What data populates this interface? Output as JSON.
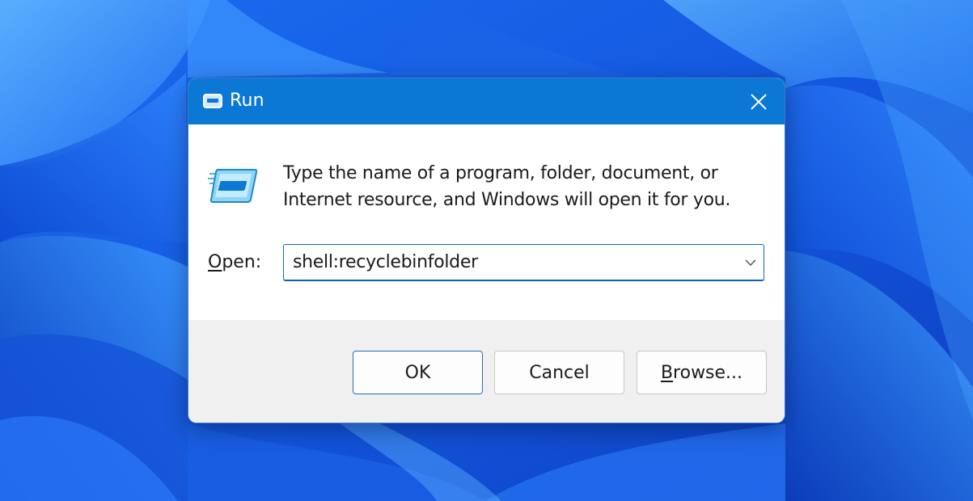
{
  "dialog": {
    "title": "Run",
    "description": "Type the name of a program, folder, document, or Internet resource, and Windows will open it for you.",
    "open_label_mnemonic": "O",
    "open_label_rest": "pen:",
    "open_value": "shell:recyclebinfolder"
  },
  "buttons": {
    "ok": "OK",
    "cancel": "Cancel",
    "browse_mnemonic": "B",
    "browse_rest": "rowse..."
  },
  "icons": {
    "title": "run-icon",
    "content": "run-icon",
    "close": "close-icon",
    "dropdown": "chevron-down-icon"
  },
  "colors": {
    "titlebar": "#0a78d4",
    "accent": "#1565c0",
    "footer": "#f0f0f0",
    "wallpaper": "#1a5fe0"
  }
}
